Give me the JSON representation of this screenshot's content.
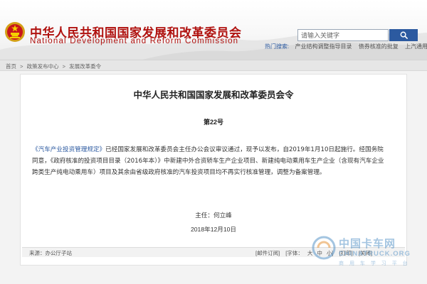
{
  "header": {
    "title_cn": "中华人民共和国国家发展和改革委员会",
    "title_en": "National Development and Reform Commission",
    "emblem_icon": "national-emblem-icon",
    "accent_color": "#b0120f"
  },
  "search": {
    "placeholder": "请输入关键字",
    "button_icon": "search-icon",
    "button_color": "#2c5aa0"
  },
  "hot_search": {
    "label": "热门搜索:",
    "links": [
      "产业结构调整指导目录",
      "债券核准的批复",
      "上汽通用"
    ]
  },
  "breadcrumb": {
    "items": [
      "首页",
      "政策发布中心",
      "发展改革委令"
    ],
    "separator": ">"
  },
  "article": {
    "title": "中华人民共和国国家发展和改革委员会令",
    "number": "第22号",
    "para1_link": "《汽车产业投资管理规定》",
    "para1_rest": "已经国家发展和改革委员会主任办公会议审议通过，现予以发布，自2019年1月10日起施行。经国务院同意，《政府核准的投资项目目录（2016年本）》中新建中外合资轿车生产企业项目、新建纯电动乘用车生产企业（含现有汽车企业跨类生产纯电动乘用车）项目及其余由省级政府核准的汽车投资项目均不再实行核准管理，调整为备案管理。",
    "signer": "主任：何立峰",
    "date": "2018年12月10日"
  },
  "footer": {
    "source": "来源：办公厅子站",
    "subscribe": "[邮件订阅]",
    "font_label": "[字体：",
    "font_large": "大",
    "font_medium": "中",
    "font_small": "小]",
    "print": "[打印]",
    "close": "[关闭]"
  },
  "watermark": {
    "cn": "中国卡车网",
    "en": "CHINATRUCK.ORG",
    "dots": "商 用 车 学 习 平 台"
  }
}
